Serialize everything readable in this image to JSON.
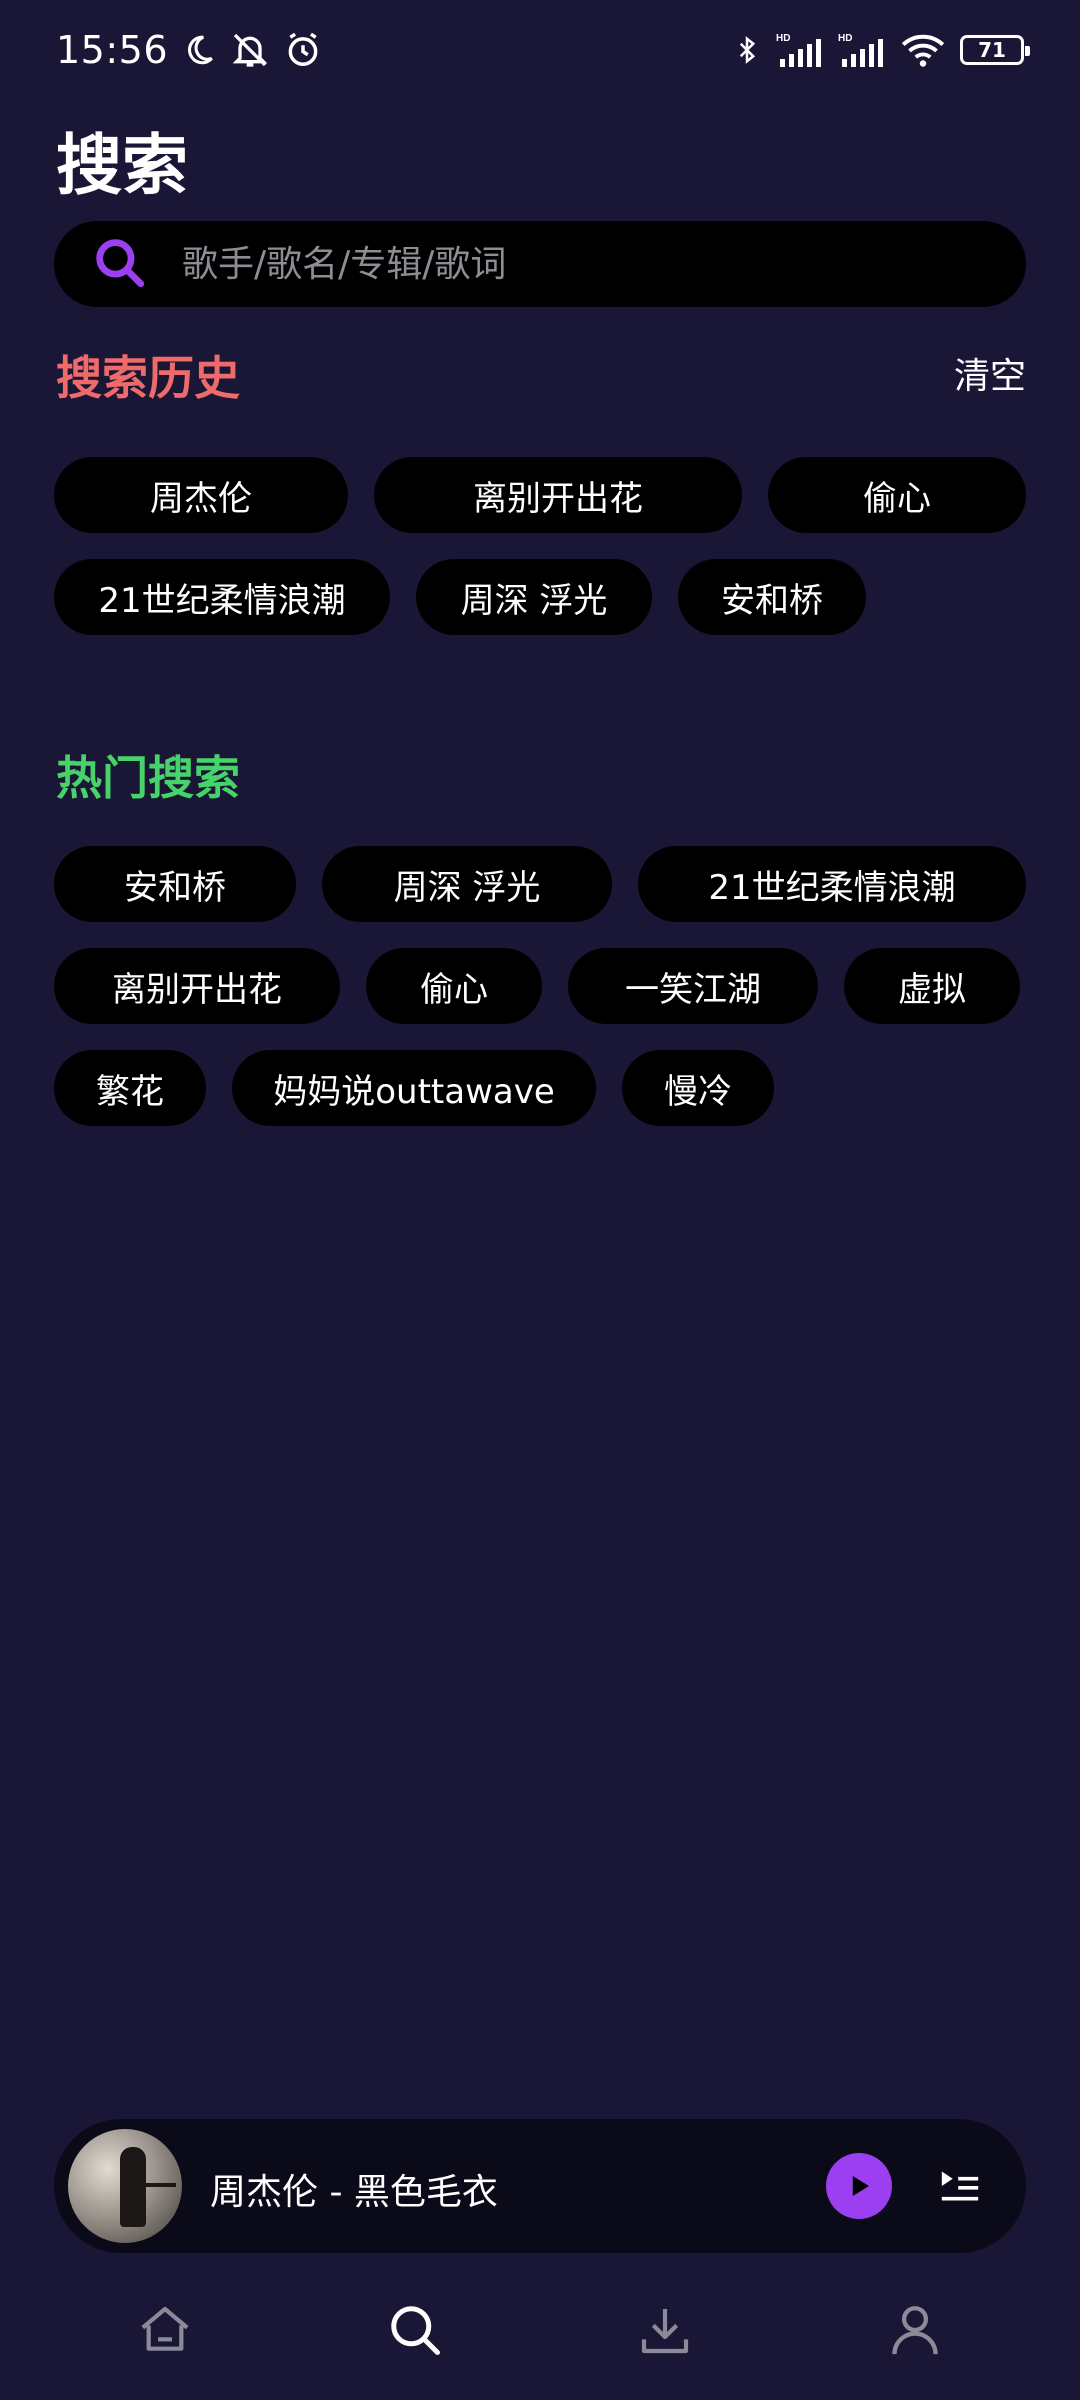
{
  "status_bar": {
    "time": "15:56",
    "battery": "71",
    "left_icons": [
      "moon-icon",
      "bell-off-icon",
      "alarm-icon"
    ],
    "right_icons": [
      "bluetooth-icon",
      "signal-hd-icon",
      "signal-hd-icon",
      "wifi-icon",
      "battery-icon"
    ]
  },
  "header": {
    "title": "搜索"
  },
  "search": {
    "placeholder": "歌手/歌名/专辑/歌词",
    "value": ""
  },
  "history": {
    "title": "搜索历史",
    "clear_label": "清空",
    "items": [
      "周杰伦",
      "离别开出花",
      "偷心",
      "21世纪柔情浪潮",
      "周深 浮光",
      "安和桥"
    ]
  },
  "hot": {
    "title": "热门搜索",
    "items": [
      "安和桥",
      "周深 浮光",
      "21世纪柔情浪潮",
      "离别开出花",
      "偷心",
      "一笑江湖",
      "虚拟",
      "繁花",
      "妈妈说outtawave",
      "慢冷"
    ]
  },
  "player": {
    "now_playing": "周杰伦 - 黑色毛衣"
  },
  "nav": {
    "items": [
      "home-icon",
      "search-icon",
      "download-icon",
      "profile-icon"
    ]
  },
  "colors": {
    "background": "#1a1635",
    "accent": "#9b3ff0",
    "history_title": "#ef6b6b",
    "hot_title": "#46d36a"
  }
}
